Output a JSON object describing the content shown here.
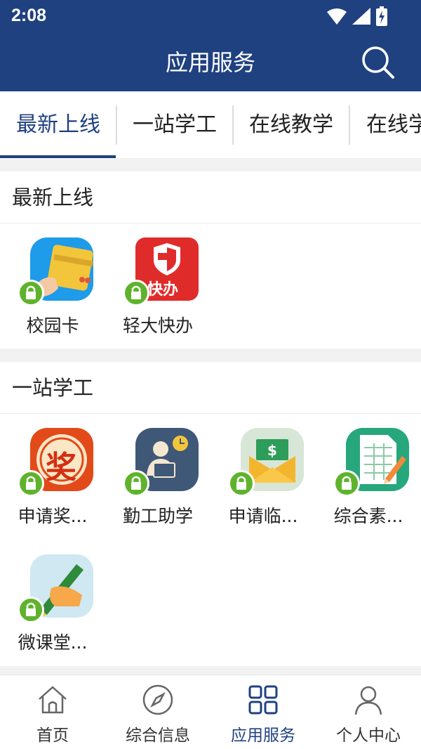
{
  "status_bar": {
    "time": "2:08"
  },
  "header": {
    "title": "应用服务"
  },
  "tabs": [
    "最新上线",
    "一站学工",
    "在线教学",
    "在线学"
  ],
  "sections": [
    {
      "title": "最新上线",
      "apps": [
        {
          "label": "校园卡",
          "icon": "campus-card-icon"
        },
        {
          "label": "轻大快办",
          "icon": "kuaiban-shield-icon",
          "badge_text": "快办"
        }
      ]
    },
    {
      "title": "一站学工",
      "apps": [
        {
          "label": "申请奖...",
          "icon": "scholarship-icon",
          "badge_text": "奖"
        },
        {
          "label": "勤工助学",
          "icon": "work-study-icon"
        },
        {
          "label": "申请临...",
          "icon": "money-envelope-icon"
        },
        {
          "label": "综合素...",
          "icon": "spreadsheet-icon"
        },
        {
          "label": "微课堂...",
          "icon": "pen-writing-icon"
        }
      ]
    }
  ],
  "bottom_nav": [
    {
      "label": "首页",
      "icon": "home-icon"
    },
    {
      "label": "综合信息",
      "icon": "compass-icon"
    },
    {
      "label": "应用服务",
      "icon": "grid-icon",
      "active": true
    },
    {
      "label": "个人中心",
      "icon": "person-icon"
    }
  ],
  "colors": {
    "primary": "#1f4180",
    "lock_green": "#5fb32c",
    "background": "#f2f2f2"
  }
}
